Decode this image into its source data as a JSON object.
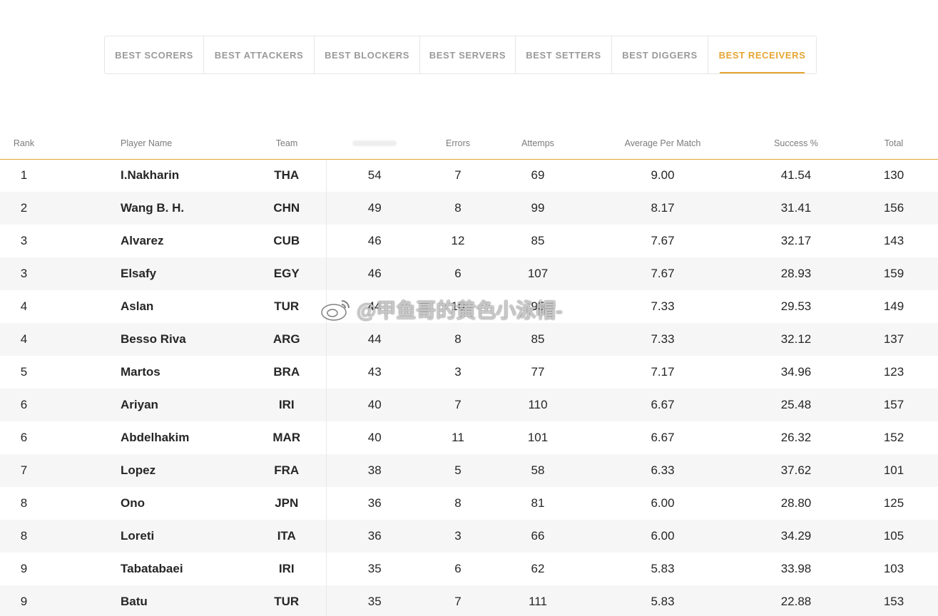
{
  "tabs": [
    {
      "label": "BEST SCORERS",
      "active": false
    },
    {
      "label": "BEST ATTACKERS",
      "active": false
    },
    {
      "label": "BEST BLOCKERS",
      "active": false
    },
    {
      "label": "BEST SERVERS",
      "active": false
    },
    {
      "label": "BEST SETTERS",
      "active": false
    },
    {
      "label": "BEST DIGGERS",
      "active": false
    },
    {
      "label": "BEST RECEIVERS",
      "active": true
    }
  ],
  "accent_color": "#e6a532",
  "table": {
    "headers": {
      "rank": "Rank",
      "player": "Player Name",
      "team": "Team",
      "successful": "",
      "errors": "Errors",
      "attempts": "Attemps",
      "average": "Average Per Match",
      "success_pct": "Success %",
      "total": "Total"
    },
    "rows": [
      {
        "rank": "1",
        "player": "I.Nakharin",
        "team": "THA",
        "successful": "54",
        "errors": "7",
        "attempts": "69",
        "average": "9.00",
        "success_pct": "41.54",
        "total": "130"
      },
      {
        "rank": "2",
        "player": "Wang B. H.",
        "team": "CHN",
        "successful": "49",
        "errors": "8",
        "attempts": "99",
        "average": "8.17",
        "success_pct": "31.41",
        "total": "156"
      },
      {
        "rank": "3",
        "player": "Alvarez",
        "team": "CUB",
        "successful": "46",
        "errors": "12",
        "attempts": "85",
        "average": "7.67",
        "success_pct": "32.17",
        "total": "143"
      },
      {
        "rank": "3",
        "player": "Elsafy",
        "team": "EGY",
        "successful": "46",
        "errors": "6",
        "attempts": "107",
        "average": "7.67",
        "success_pct": "28.93",
        "total": "159"
      },
      {
        "rank": "4",
        "player": "Aslan",
        "team": "TUR",
        "successful": "44",
        "errors": "10",
        "attempts": "95",
        "average": "7.33",
        "success_pct": "29.53",
        "total": "149"
      },
      {
        "rank": "4",
        "player": "Besso Riva",
        "team": "ARG",
        "successful": "44",
        "errors": "8",
        "attempts": "85",
        "average": "7.33",
        "success_pct": "32.12",
        "total": "137"
      },
      {
        "rank": "5",
        "player": "Martos",
        "team": "BRA",
        "successful": "43",
        "errors": "3",
        "attempts": "77",
        "average": "7.17",
        "success_pct": "34.96",
        "total": "123"
      },
      {
        "rank": "6",
        "player": "Ariyan",
        "team": "IRI",
        "successful": "40",
        "errors": "7",
        "attempts": "110",
        "average": "6.67",
        "success_pct": "25.48",
        "total": "157"
      },
      {
        "rank": "6",
        "player": "Abdelhakim",
        "team": "MAR",
        "successful": "40",
        "errors": "11",
        "attempts": "101",
        "average": "6.67",
        "success_pct": "26.32",
        "total": "152"
      },
      {
        "rank": "7",
        "player": "Lopez",
        "team": "FRA",
        "successful": "38",
        "errors": "5",
        "attempts": "58",
        "average": "6.33",
        "success_pct": "37.62",
        "total": "101"
      },
      {
        "rank": "8",
        "player": "Ono",
        "team": "JPN",
        "successful": "36",
        "errors": "8",
        "attempts": "81",
        "average": "6.00",
        "success_pct": "28.80",
        "total": "125"
      },
      {
        "rank": "8",
        "player": "Loreti",
        "team": "ITA",
        "successful": "36",
        "errors": "3",
        "attempts": "66",
        "average": "6.00",
        "success_pct": "34.29",
        "total": "105"
      },
      {
        "rank": "9",
        "player": "Tabatabaei",
        "team": "IRI",
        "successful": "35",
        "errors": "6",
        "attempts": "62",
        "average": "5.83",
        "success_pct": "33.98",
        "total": "103"
      },
      {
        "rank": "9",
        "player": "Batu",
        "team": "TUR",
        "successful": "35",
        "errors": "7",
        "attempts": "111",
        "average": "5.83",
        "success_pct": "22.88",
        "total": "153"
      }
    ]
  },
  "watermark": {
    "text": "@甲鱼哥的黄色小泳帽-",
    "icon": "weibo-icon"
  }
}
